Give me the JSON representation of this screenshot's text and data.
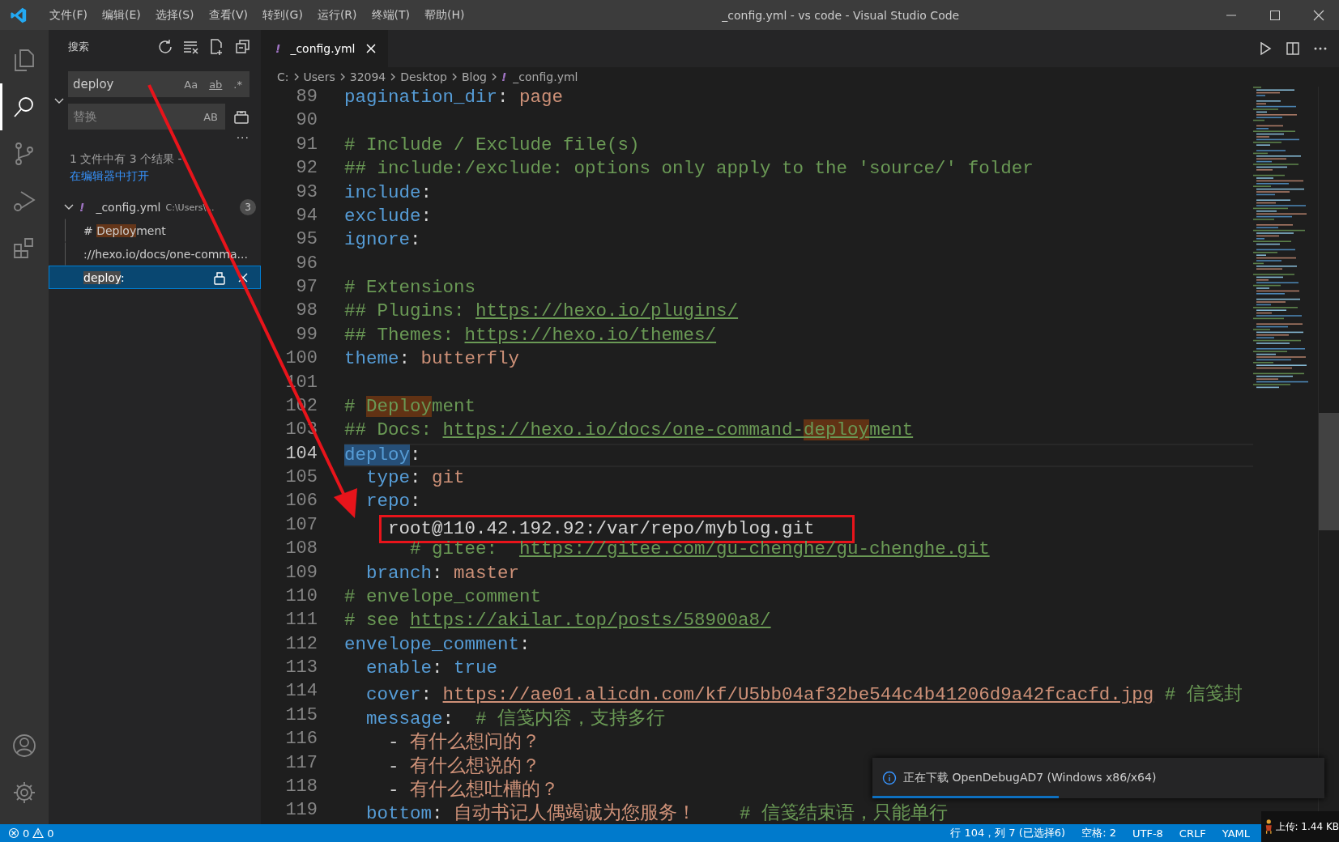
{
  "window": {
    "title": "_config.yml - vs code - Visual Studio Code"
  },
  "menu": [
    "文件(F)",
    "编辑(E)",
    "选择(S)",
    "查看(V)",
    "转到(G)",
    "运行(R)",
    "终端(T)",
    "帮助(H)"
  ],
  "activity_bar": [
    {
      "kind": "files",
      "selected": false
    },
    {
      "kind": "search",
      "selected": true
    },
    {
      "kind": "source-control",
      "selected": false
    },
    {
      "kind": "run-debug",
      "selected": false
    },
    {
      "kind": "extensions",
      "selected": false
    }
  ],
  "activity_bar_bottom": [
    {
      "kind": "account"
    },
    {
      "kind": "settings"
    }
  ],
  "sidebar": {
    "title": "搜索",
    "search": {
      "value": "deploy",
      "toggles": [
        {
          "label": "Aa",
          "on": false
        },
        {
          "label": "ab",
          "on": false
        },
        {
          "label": ".*",
          "on": false
        }
      ]
    },
    "replace": {
      "placeholder": "替换",
      "expanded": true,
      "toggle": "AB"
    },
    "more": "···",
    "results_message": {
      "text": "1 文件中有 3 个结果 - ",
      "link": "在编辑器中打开"
    },
    "results": [
      {
        "icon": "!",
        "file": "_config.yml",
        "path": "C:\\Users\\...",
        "count": "3",
        "expanded": true,
        "matches": [
          {
            "selected": false,
            "segs": [
              {
                "t": "# "
              },
              {
                "t": "Deploy",
                "hl": true
              },
              {
                "t": "ment"
              }
            ]
          },
          {
            "selected": false,
            "segs": [
              {
                "t": "://hexo.io/docs/one-comma..."
              }
            ]
          },
          {
            "selected": true,
            "segs": [
              {
                "t": "deploy",
                "hl": true
              },
              {
                "t": ":"
              }
            ]
          }
        ]
      }
    ]
  },
  "editor": {
    "tabs": [
      {
        "icon": "!",
        "label": "_config.yml",
        "selected": true
      }
    ],
    "breadcrumb": [
      {
        "label": "C:"
      },
      {
        "label": "Users"
      },
      {
        "label": "32094"
      },
      {
        "label": "Desktop"
      },
      {
        "label": "Blog"
      },
      {
        "icon": "!",
        "label": "_config.yml"
      }
    ],
    "lines": [
      {
        "n": "89",
        "current": false,
        "segs": [
          {
            "t": "pagination_dir",
            "kind": "key"
          },
          {
            "t": ": ",
            "kind": "plain"
          },
          {
            "t": "page",
            "kind": "val"
          }
        ]
      },
      {
        "n": "90",
        "current": false
      },
      {
        "n": "91",
        "current": false,
        "segs": [
          {
            "t": "# Include / Exclude file(s)",
            "kind": "comment"
          }
        ]
      },
      {
        "n": "92",
        "current": false,
        "segs": [
          {
            "t": "## include:/exclude: options only apply to the 'source/' folder",
            "kind": "comment"
          }
        ]
      },
      {
        "n": "93",
        "current": false,
        "segs": [
          {
            "t": "include",
            "kind": "key"
          },
          {
            "t": ":",
            "kind": "plain"
          }
        ]
      },
      {
        "n": "94",
        "current": false,
        "segs": [
          {
            "t": "exclude",
            "kind": "key"
          },
          {
            "t": ":",
            "kind": "plain"
          }
        ]
      },
      {
        "n": "95",
        "current": false,
        "segs": [
          {
            "t": "ignore",
            "kind": "key"
          },
          {
            "t": ":",
            "kind": "plain"
          }
        ]
      },
      {
        "n": "96",
        "current": false
      },
      {
        "n": "97",
        "current": false,
        "segs": [
          {
            "t": "# Extensions",
            "kind": "comment"
          }
        ]
      },
      {
        "n": "98",
        "current": false,
        "segs": [
          {
            "t": "## Plugins: ",
            "kind": "comment"
          },
          {
            "t": "https://hexo.io/plugins/",
            "kind": "comment-link"
          }
        ]
      },
      {
        "n": "99",
        "current": false,
        "segs": [
          {
            "t": "## Themes: ",
            "kind": "comment"
          },
          {
            "t": "https://hexo.io/themes/",
            "kind": "comment-link"
          }
        ]
      },
      {
        "n": "100",
        "current": false,
        "segs": [
          {
            "t": "theme",
            "kind": "key"
          },
          {
            "t": ": ",
            "kind": "plain"
          },
          {
            "t": "butterfly",
            "kind": "val"
          }
        ]
      },
      {
        "n": "101",
        "current": false
      },
      {
        "n": "102",
        "current": false,
        "segs": [
          {
            "t": "# ",
            "kind": "comment"
          },
          {
            "t": "Deploy",
            "kind": "comment",
            "match": true
          },
          {
            "t": "ment",
            "kind": "comment"
          }
        ]
      },
      {
        "n": "103",
        "current": false,
        "segs": [
          {
            "t": "## Docs: ",
            "kind": "comment"
          },
          {
            "t": "https://hexo.io/docs/one-command-",
            "kind": "comment-link"
          },
          {
            "t": "deploy",
            "kind": "comment-link",
            "match": true
          },
          {
            "t": "ment",
            "kind": "comment-link"
          }
        ]
      },
      {
        "n": "104",
        "current": true,
        "segs": [
          {
            "t": "deploy",
            "kind": "key",
            "selected": true
          },
          {
            "t": ":",
            "kind": "plain"
          }
        ]
      },
      {
        "n": "105",
        "current": false,
        "segs": [
          {
            "t": "  type",
            "kind": "key"
          },
          {
            "t": ": ",
            "kind": "plain"
          },
          {
            "t": "git",
            "kind": "val"
          }
        ]
      },
      {
        "n": "106",
        "current": false,
        "segs": [
          {
            "t": "  repo",
            "kind": "key"
          },
          {
            "t": ":",
            "kind": "plain"
          }
        ]
      },
      {
        "n": "107",
        "current": false,
        "boxed": true,
        "segs": [
          {
            "t": "    root@110.42.192.92:/var/repo/myblog.git",
            "kind": "plain"
          }
        ]
      },
      {
        "n": "108",
        "current": false,
        "segs": [
          {
            "t": "      # gitee:  ",
            "kind": "comment"
          },
          {
            "t": "https://gitee.com/gu-chenghe/gu-chenghe.git",
            "kind": "comment-link"
          }
        ]
      },
      {
        "n": "109",
        "current": false,
        "segs": [
          {
            "t": "  branch",
            "kind": "key"
          },
          {
            "t": ": ",
            "kind": "plain"
          },
          {
            "t": "master",
            "kind": "val"
          }
        ]
      },
      {
        "n": "110",
        "current": false,
        "segs": [
          {
            "t": "# envelope_comment",
            "kind": "comment"
          }
        ]
      },
      {
        "n": "111",
        "current": false,
        "segs": [
          {
            "t": "# see ",
            "kind": "comment"
          },
          {
            "t": "https://akilar.top/posts/58900a8/",
            "kind": "comment-link"
          }
        ]
      },
      {
        "n": "112",
        "current": false,
        "segs": [
          {
            "t": "envelope_comment",
            "kind": "key"
          },
          {
            "t": ":",
            "kind": "plain"
          }
        ]
      },
      {
        "n": "113",
        "current": false,
        "segs": [
          {
            "t": "  enable",
            "kind": "key"
          },
          {
            "t": ": ",
            "kind": "plain"
          },
          {
            "t": "true",
            "kind": "bool"
          }
        ]
      },
      {
        "n": "114",
        "current": false,
        "segs": [
          {
            "t": "  cover",
            "kind": "key"
          },
          {
            "t": ": ",
            "kind": "plain"
          },
          {
            "t": "https://ae01.alicdn.com/kf/U5bb04af32be544c4b41206d9a42fcacfd.jpg",
            "kind": "val-link"
          },
          {
            "t": " # 信笺封",
            "kind": "comment"
          }
        ]
      },
      {
        "n": "115",
        "current": false,
        "segs": [
          {
            "t": "  message",
            "kind": "key"
          },
          {
            "t": ":  ",
            "kind": "plain"
          },
          {
            "t": "# 信笺内容，支持多行",
            "kind": "comment"
          }
        ]
      },
      {
        "n": "116",
        "current": false,
        "segs": [
          {
            "t": "    - ",
            "kind": "plain"
          },
          {
            "t": "有什么想问的？",
            "kind": "val"
          }
        ]
      },
      {
        "n": "117",
        "current": false,
        "segs": [
          {
            "t": "    - ",
            "kind": "plain"
          },
          {
            "t": "有什么想说的？",
            "kind": "val"
          }
        ]
      },
      {
        "n": "118",
        "current": false,
        "segs": [
          {
            "t": "    - ",
            "kind": "plain"
          },
          {
            "t": "有什么想吐槽的？",
            "kind": "val"
          }
        ]
      },
      {
        "n": "119",
        "current": false,
        "segs": [
          {
            "t": "  bottom",
            "kind": "key"
          },
          {
            "t": ": ",
            "kind": "plain"
          },
          {
            "t": "自动书记人偶竭诚为您服务！",
            "kind": "val"
          },
          {
            "t": "    # 信笺结束语，只能单行",
            "kind": "comment"
          }
        ]
      }
    ]
  },
  "notification": {
    "text": "正在下载 OpenDebugAD7 (Windows x86/x64)"
  },
  "status_bar": {
    "errors": "0",
    "warnings": "0",
    "items": [
      "行 104，列 7 (已选择6)",
      "空格: 2",
      "UTF-8",
      "CRLF",
      "YAML"
    ]
  },
  "net_widget": {
    "text": "上传: 1.44 KB"
  }
}
